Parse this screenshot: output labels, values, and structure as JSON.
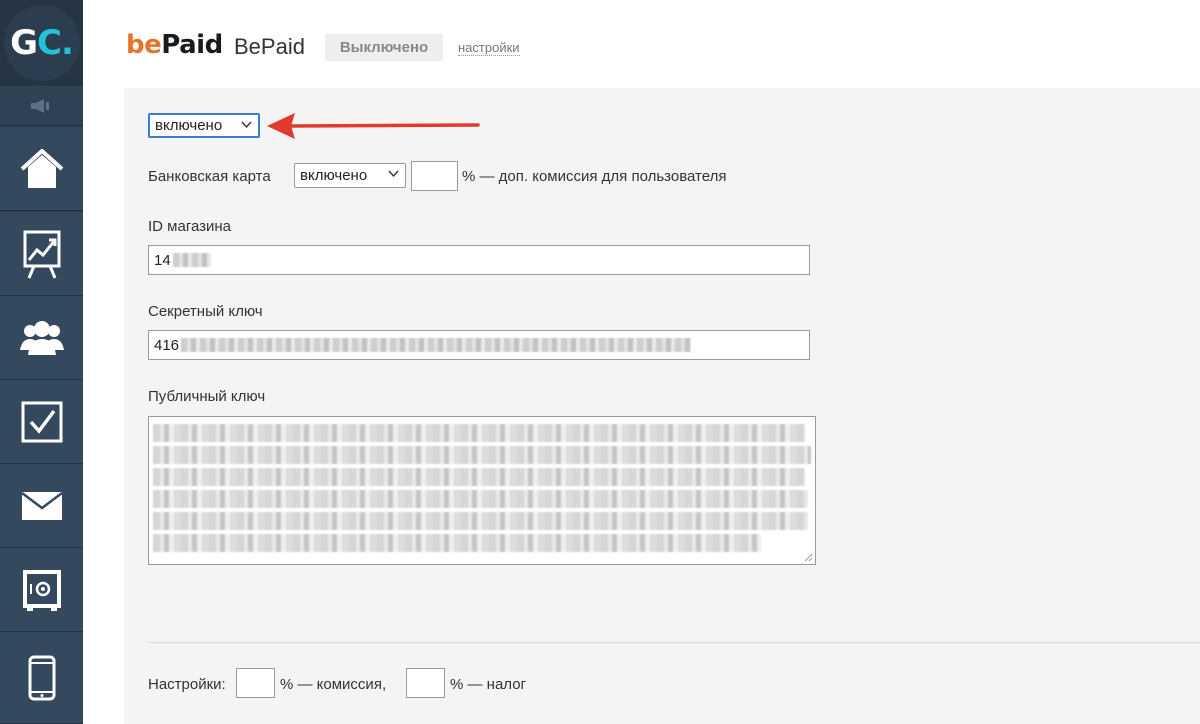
{
  "sidebar": {
    "logo_g": "G",
    "logo_c": "C.",
    "items": [
      {
        "icon": "speaker-icon"
      },
      {
        "icon": "home-icon"
      },
      {
        "icon": "chart-icon"
      },
      {
        "icon": "users-icon"
      },
      {
        "icon": "checkbox-icon"
      },
      {
        "icon": "mail-icon"
      },
      {
        "icon": "safe-icon"
      },
      {
        "icon": "mobile-icon"
      }
    ]
  },
  "header": {
    "brand_be": "be",
    "brand_paid": "Paid",
    "provider_name": "BePaid",
    "status": "Выключено",
    "settings_link": "настройки"
  },
  "form": {
    "enabled_select": "включено",
    "card_label": "Банковская карта",
    "card_select": "включено",
    "card_commission_value": "",
    "card_commission_suffix": "% — доп. комиссия для пользователя",
    "shop_id_label": "ID магазина",
    "shop_id_value": "14",
    "secret_key_label": "Секретный ключ",
    "secret_key_value": "416",
    "public_key_label": "Публичный ключ",
    "settings_label": "Настройки:",
    "commission_suffix": "% — комиссия,",
    "tax_suffix": "% — налог"
  },
  "colors": {
    "sidebar": "#34495e",
    "accent_orange": "#e8742b",
    "logo_cyan": "#21c3d8",
    "arrow_red": "#e03a2f",
    "select_focus": "#3d7bd1"
  }
}
